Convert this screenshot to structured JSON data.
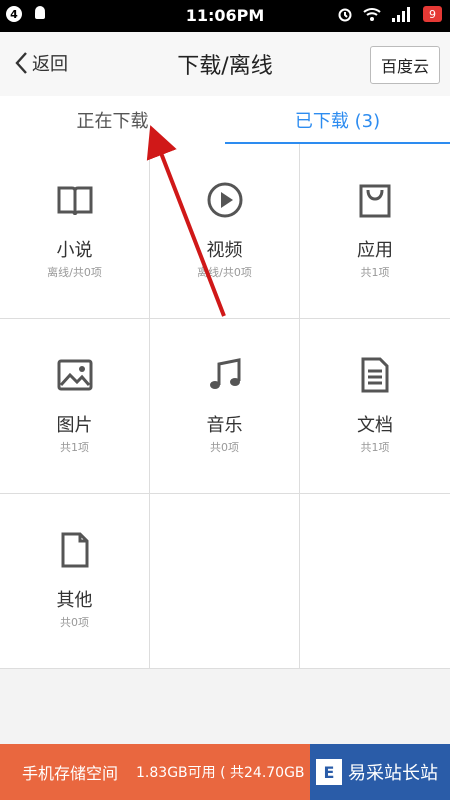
{
  "status_bar": {
    "time": "11:06PM",
    "notif_count": "4",
    "battery": "9"
  },
  "header": {
    "back_label": "返回",
    "title": "下载/离线",
    "cloud_button": "百度云"
  },
  "tabs": [
    {
      "label": "正在下载"
    },
    {
      "label": "已下载 (3)"
    }
  ],
  "categories": [
    {
      "name": "小说",
      "info": "离线/共0项",
      "icon": "book-icon"
    },
    {
      "name": "视频",
      "info": "离线/共0项",
      "icon": "play-circle-icon"
    },
    {
      "name": "应用",
      "info": "共1项",
      "icon": "bag-icon"
    },
    {
      "name": "图片",
      "info": "共1项",
      "icon": "image-icon"
    },
    {
      "name": "音乐",
      "info": "共0项",
      "icon": "music-note-icon"
    },
    {
      "name": "文档",
      "info": "共1项",
      "icon": "document-icon"
    },
    {
      "name": "其他",
      "info": "共0项",
      "icon": "file-icon"
    }
  ],
  "footer": {
    "storage_label": "手机存储空间",
    "storage_value": "1.83GB可用 ( 共24.70GB"
  },
  "watermark": {
    "logo": "E",
    "text": "易采站长站"
  },
  "colors": {
    "accent": "#2d8cf0",
    "footer": "#e9673f",
    "arrow": "#d01818"
  }
}
